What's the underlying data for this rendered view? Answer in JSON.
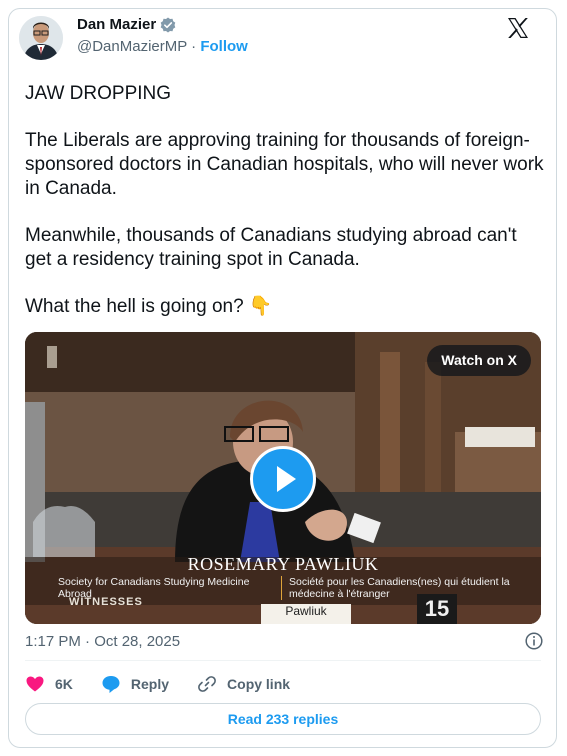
{
  "author": {
    "name": "Dan Mazier",
    "handle": "@DanMazierMP",
    "separator": "·",
    "follow_label": "Follow"
  },
  "tweet": {
    "paragraphs": [
      "JAW DROPPING",
      "The Liberals are approving training for thousands of foreign-sponsored doctors in Canadian hospitals, who will never work in Canada.",
      "Meanwhile, thousands of Canadians studying abroad can't get a residency training spot in Canada.",
      "What the hell is going on? 👇"
    ]
  },
  "media": {
    "watch_label": "Watch on X",
    "nameplate": "ROSEMARY PAWLIUK",
    "org_en": "Society for Canadians Studying Medicine Abroad",
    "org_fr": "Société pour les Canadiens(nes) qui étudient la médecine à l'étranger",
    "sign_left": "WITNESSES",
    "sign_name": "Pawliuk",
    "channel_number": "15"
  },
  "timestamp": "1:17 PM · Oct 28, 2025",
  "actions": {
    "likes": "6K",
    "reply_label": "Reply",
    "copy_label": "Copy link"
  },
  "read_replies_label": "Read 233 replies",
  "colors": {
    "accent": "#1d9bf0",
    "like": "#f91880",
    "muted": "#536471"
  }
}
